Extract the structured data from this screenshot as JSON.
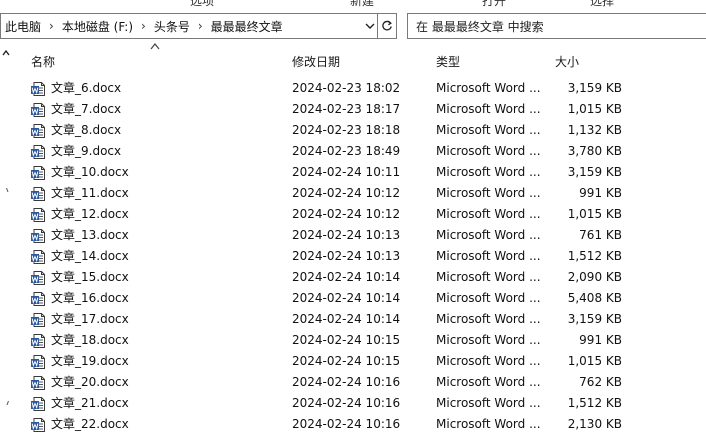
{
  "ribbon": {
    "labels": [
      "选项",
      "新建",
      "打开",
      "选择"
    ]
  },
  "breadcrumb": {
    "items": [
      "此电脑",
      "本地磁盘 (F:)",
      "头条号",
      "最最最终文章"
    ],
    "separator": "›"
  },
  "search": {
    "placeholder": "在 最最最终文章 中搜索"
  },
  "columns": {
    "name": "名称",
    "date": "修改日期",
    "type": "类型",
    "size": "大小"
  },
  "files": [
    {
      "name": "文章_6.docx",
      "date": "2024-02-23 18:02",
      "type": "Microsoft Word ...",
      "size": "3,159 KB"
    },
    {
      "name": "文章_7.docx",
      "date": "2024-02-23 18:17",
      "type": "Microsoft Word ...",
      "size": "1,015 KB"
    },
    {
      "name": "文章_8.docx",
      "date": "2024-02-23 18:18",
      "type": "Microsoft Word ...",
      "size": "1,132 KB"
    },
    {
      "name": "文章_9.docx",
      "date": "2024-02-23 18:49",
      "type": "Microsoft Word ...",
      "size": "3,780 KB"
    },
    {
      "name": "文章_10.docx",
      "date": "2024-02-24 10:11",
      "type": "Microsoft Word ...",
      "size": "3,159 KB"
    },
    {
      "name": "文章_11.docx",
      "date": "2024-02-24 10:12",
      "type": "Microsoft Word ...",
      "size": "991 KB"
    },
    {
      "name": "文章_12.docx",
      "date": "2024-02-24 10:12",
      "type": "Microsoft Word ...",
      "size": "1,015 KB"
    },
    {
      "name": "文章_13.docx",
      "date": "2024-02-24 10:13",
      "type": "Microsoft Word ...",
      "size": "761 KB"
    },
    {
      "name": "文章_14.docx",
      "date": "2024-02-24 10:13",
      "type": "Microsoft Word ...",
      "size": "1,512 KB"
    },
    {
      "name": "文章_15.docx",
      "date": "2024-02-24 10:14",
      "type": "Microsoft Word ...",
      "size": "2,090 KB"
    },
    {
      "name": "文章_16.docx",
      "date": "2024-02-24 10:14",
      "type": "Microsoft Word ...",
      "size": "5,408 KB"
    },
    {
      "name": "文章_17.docx",
      "date": "2024-02-24 10:14",
      "type": "Microsoft Word ...",
      "size": "3,159 KB"
    },
    {
      "name": "文章_18.docx",
      "date": "2024-02-24 10:15",
      "type": "Microsoft Word ...",
      "size": "991 KB"
    },
    {
      "name": "文章_19.docx",
      "date": "2024-02-24 10:15",
      "type": "Microsoft Word ...",
      "size": "1,015 KB"
    },
    {
      "name": "文章_20.docx",
      "date": "2024-02-24 10:16",
      "type": "Microsoft Word ...",
      "size": "762 KB"
    },
    {
      "name": "文章_21.docx",
      "date": "2024-02-24 10:16",
      "type": "Microsoft Word ...",
      "size": "1,512 KB"
    },
    {
      "name": "文章_22.docx",
      "date": "2024-02-24 10:16",
      "type": "Microsoft Word ...",
      "size": "2,130 KB"
    }
  ],
  "icons": {
    "file": "word-document-icon",
    "dropdown": "chevron-down-icon",
    "refresh": "refresh-icon",
    "sort": "sort-ascending-icon",
    "expand": "chevron-up-icon"
  },
  "colors": {
    "word_blue": "#2b579a",
    "border": "#7a7a7a"
  }
}
